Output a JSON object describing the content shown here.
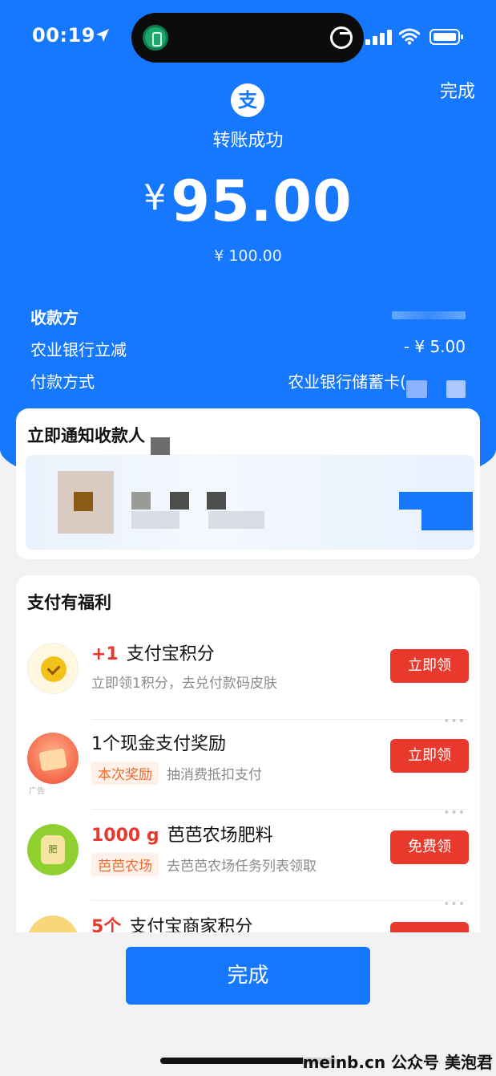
{
  "status_bar": {
    "time": "00:19"
  },
  "header": {
    "done_label": "完成",
    "logo_char": "支",
    "title": "转账成功"
  },
  "amount": {
    "currency": "¥",
    "value": "95.00",
    "original": "¥ 100.00"
  },
  "details": [
    {
      "label": "收款方",
      "value": ""
    },
    {
      "label": "农业银行立减",
      "value": "- ¥ 5.00"
    },
    {
      "label": "付款方式",
      "value": "农业银行储蓄卡("
    }
  ],
  "notify_card": {
    "title": "立即通知收款人"
  },
  "benefits": {
    "title": "支付有福利",
    "items": [
      {
        "highlight": "+1",
        "title": "支付宝积分",
        "tag": "",
        "subtitle": "立即领1积分，去兑付款码皮肤",
        "button": "立即领",
        "icon": "points-coin-icon",
        "ad": ""
      },
      {
        "highlight": "",
        "title": "1个现金支付奖励",
        "tag": "本次奖励",
        "subtitle": "抽消费抵扣支付",
        "button": "立即领",
        "icon": "cash-reward-icon",
        "ad": "广告"
      },
      {
        "highlight": "1000 g",
        "title": "芭芭农场肥料",
        "tag": "芭芭农场",
        "subtitle": "去芭芭农场任务列表领取",
        "button": "免费领",
        "icon": "fertilizer-bag-icon",
        "ad": ""
      },
      {
        "highlight": "5个",
        "title": "支付宝商家积分",
        "tag": "",
        "subtitle": "",
        "button": "",
        "icon": "merchant-points-icon",
        "ad": ""
      }
    ]
  },
  "footer": {
    "done_label": "完成"
  },
  "watermark": "meinb.cn 公众号 美泡君",
  "colors": {
    "brand_blue": "#1677ff",
    "button_red": "#e8392c",
    "tag_orange": "#ee6a2c"
  }
}
